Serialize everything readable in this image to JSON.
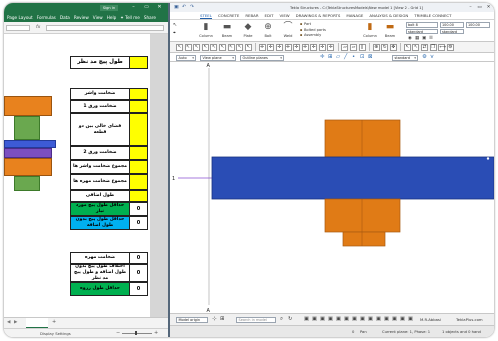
{
  "excel": {
    "sign_in": "Sign in",
    "window_controls": [
      "–",
      "▭",
      "✕"
    ],
    "ribbon_tabs": [
      "Page Layout",
      "Formulas",
      "Data",
      "Review",
      "View",
      "Help",
      "Tell me",
      "Share"
    ],
    "formula_fx": "fx",
    "table": {
      "title": {
        "label": "طول پیچ مد نظر",
        "value": "",
        "label_fill": "#ffffff",
        "value_fill": "#ffff00"
      },
      "rows": [
        {
          "label": "ضخامت واشر",
          "value": "",
          "label_fill": "#ffffff",
          "value_fill": "#ffff00"
        },
        {
          "label": "ضخامت ورق 1",
          "value": "",
          "label_fill": "#ffffff",
          "value_fill": "#ffff00"
        },
        {
          "label": "فضای خالی بین دو قطعه",
          "value": "",
          "label_fill": "#ffffff",
          "value_fill": "#ffff00"
        },
        {
          "label": "ضخامت ورق 2",
          "value": "",
          "label_fill": "#ffffff",
          "value_fill": "#ffff00"
        },
        {
          "label": "مجموع ضخامت واشر ها",
          "value": "",
          "label_fill": "#ffffff",
          "value_fill": "#ffff00"
        },
        {
          "label": "مجموع ضخامت مهره ها",
          "value": "",
          "label_fill": "#ffffff",
          "value_fill": "#ffff00"
        },
        {
          "label": "طول اضافی",
          "value": "",
          "label_fill": "#ffffff",
          "value_fill": "#ffff00"
        },
        {
          "label": "حداقل طول پیچ مورد نیاز",
          "value": "0",
          "label_fill": "#00b050",
          "value_fill": "#ffffff"
        },
        {
          "label": "حداقل طول پیچ بدون طول اضافه",
          "value": "0",
          "label_fill": "#00b0f0",
          "value_fill": "#ffffff"
        }
      ],
      "rows2": [
        {
          "label": "ضخامت مهره",
          "value": "0",
          "label_fill": "#ffffff",
          "value_fill": "#ffffff"
        },
        {
          "label": "اختلاف طول پیچ بدون طول اضافه و طول پیچ مد نظر",
          "value": "0",
          "label_fill": "#ffffff",
          "value_fill": "#ffffff"
        },
        {
          "label": "حداقل طول رزوه",
          "value": "0",
          "label_fill": "#00b050",
          "value_fill": "#ffffff"
        }
      ]
    },
    "diagram_colors": {
      "bolt": "#e8821e",
      "nut_washer": "#6aa84f",
      "plate_top": "#3d5bd6",
      "plate_bottom": "#7b4fc0"
    },
    "status": {
      "display_settings": "Display Settings",
      "zoom_minus": "−",
      "zoom_plus": "+"
    },
    "sheet_nav": {
      "prev": "◀",
      "next": "▶",
      "add": "+"
    },
    "brand_color": "#217346"
  },
  "tekla": {
    "title": "Tekla Structures - C:\\TeklaStructuresModels\\New model 1 [View 2 - Grid 1]",
    "quick_access": [
      "▣",
      "↶",
      "↷"
    ],
    "window_controls": [
      "–",
      "▭",
      "✕"
    ],
    "tabs": [
      "STEEL",
      "CONCRETE",
      "REBAR",
      "EDIT",
      "VIEW",
      "DRAWINGS & REPORTS",
      "MANAGE",
      "ANALYSIS & DESIGN",
      "TRIMBLE CONNECT"
    ],
    "active_tab": "STEEL",
    "ribbon": {
      "left_icons": [
        "↖",
        "⌖"
      ],
      "items": [
        {
          "label": "Column",
          "icon": "▮"
        },
        {
          "label": "Beam",
          "icon": "▬"
        },
        {
          "label": "Plate",
          "icon": "◆"
        },
        {
          "label": "Bolt",
          "icon": "⊕"
        },
        {
          "label": "Weld",
          "icon": "⌒"
        }
      ],
      "list": [
        "Part",
        "Bolted parts",
        "Assembly"
      ],
      "items2": [
        {
          "label": "Column",
          "icon": "▮"
        },
        {
          "label": "Beam",
          "icon": "▬"
        }
      ],
      "fields": {
        "bolt": "bolt 8",
        "x": "100.00",
        "y": "100.00",
        "std1": "standard",
        "std2": "standard"
      }
    },
    "toolbar_icons": [
      "select-all-icon",
      "select-parts-icon",
      "select-surface-icon",
      "select-cut-icon",
      "select-weld-icon",
      "select-component-icon",
      "select-bolt-icon",
      "select-grid-icon",
      "select-reference-icon",
      "separator",
      "snap-reference-lines-icon",
      "snap-points-icon",
      "snap-center-icon",
      "snap-intersection-icon",
      "snap-midpoint-icon",
      "snap-end-icon",
      "snap-perpendicular-icon",
      "snap-line-icon",
      "snap-nearest-icon",
      "separator",
      "work-plane-icon",
      "view-plane-icon",
      "parallel-icon",
      "separator",
      "zoom-icon",
      "rotate-icon",
      "pan-icon",
      "separator",
      "select-object-icon",
      "select-assembly-icon",
      "move-icon",
      "copy-icon",
      "measure-icon",
      "settings-icon"
    ],
    "viewbar": {
      "auto": "Auto",
      "view_plane": "View plane",
      "outline": "Outline planes",
      "standard": "standard"
    },
    "grid": {
      "vertical_label": "A",
      "horizontal_label": "1"
    },
    "colors": {
      "bolt": "#e07b16",
      "bolt_edge": "#a85a10",
      "plate": "#2a4db5",
      "plate_edge": "#1a3380",
      "grid_line": "#8a4fd0"
    },
    "bottom": {
      "model_origin": "Model origin",
      "search_placeholder": "Search in model",
      "author": "M.R.Abbasi",
      "site": "TeklaPlus.com"
    },
    "status": {
      "count": "0",
      "mode": "Pan",
      "plane": "Current plane: 1, Phase: 1",
      "selection": "1 objects and 0 hand"
    }
  }
}
